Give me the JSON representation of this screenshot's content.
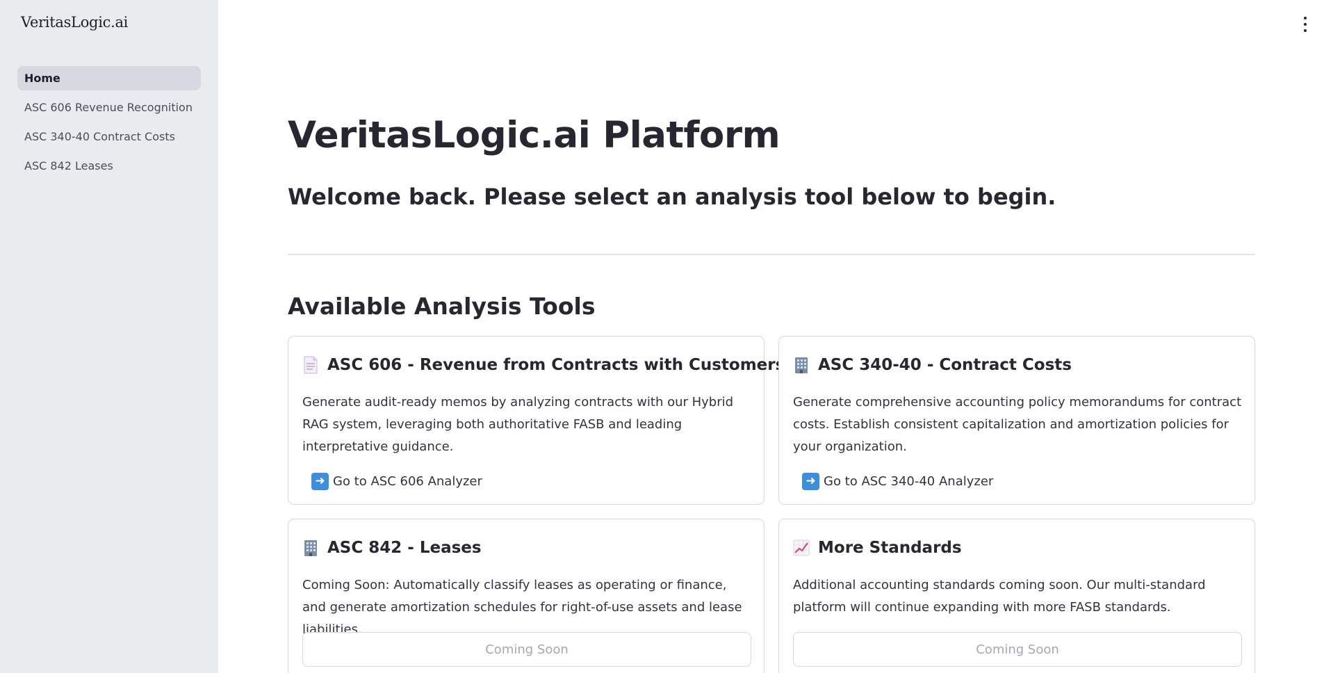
{
  "sidebar": {
    "brand": "VeritasLogic.ai",
    "items": [
      {
        "label": "Home",
        "active": true
      },
      {
        "label": "ASC 606 Revenue Recognition",
        "active": false
      },
      {
        "label": "ASC 340-40 Contract Costs",
        "active": false
      },
      {
        "label": "ASC 842 Leases",
        "active": false
      }
    ]
  },
  "header": {
    "menu_icon": "kebab-menu-icon"
  },
  "main": {
    "title": "VeritasLogic.ai Platform",
    "welcome": "Welcome back. Please select an analysis tool below to begin.",
    "section_title": "Available Analysis Tools",
    "cards": [
      {
        "icon": "document-icon",
        "title": "ASC 606 - Revenue from Contracts with Customers",
        "description": "Generate audit-ready memos by analyzing contracts with our Hybrid RAG system, leveraging both authoritative FASB and leading interpretative guidance.",
        "link_icon": "right-arrow-icon",
        "link_label": "Go to ASC 606 Analyzer"
      },
      {
        "icon": "office-building-icon",
        "title": "ASC 340-40 - Contract Costs",
        "description": "Generate comprehensive accounting policy memorandums for contract costs. Establish consistent capitalization and amortization policies for your organization.",
        "link_icon": "right-arrow-icon",
        "link_label": "Go to ASC 340-40 Analyzer"
      },
      {
        "icon": "office-building-icon",
        "title": "ASC 842 - Leases",
        "description": "Coming Soon: Automatically classify leases as operating or finance, and generate amortization schedules for right-of-use assets and lease liabilities.",
        "button_label": "Coming Soon"
      },
      {
        "icon": "chart-increasing-icon",
        "title": "More Standards",
        "description": "Additional accounting standards coming soon. Our multi-standard platform will continue expanding with more FASB standards.",
        "button_label": "Coming Soon"
      }
    ]
  },
  "colors": {
    "sidebar_bg": "#e9ecef",
    "active_item_bg": "#d6d9df",
    "text": "#262730",
    "arrow_blue": "#3e8ede",
    "disabled_text": "#a6a8ae"
  }
}
